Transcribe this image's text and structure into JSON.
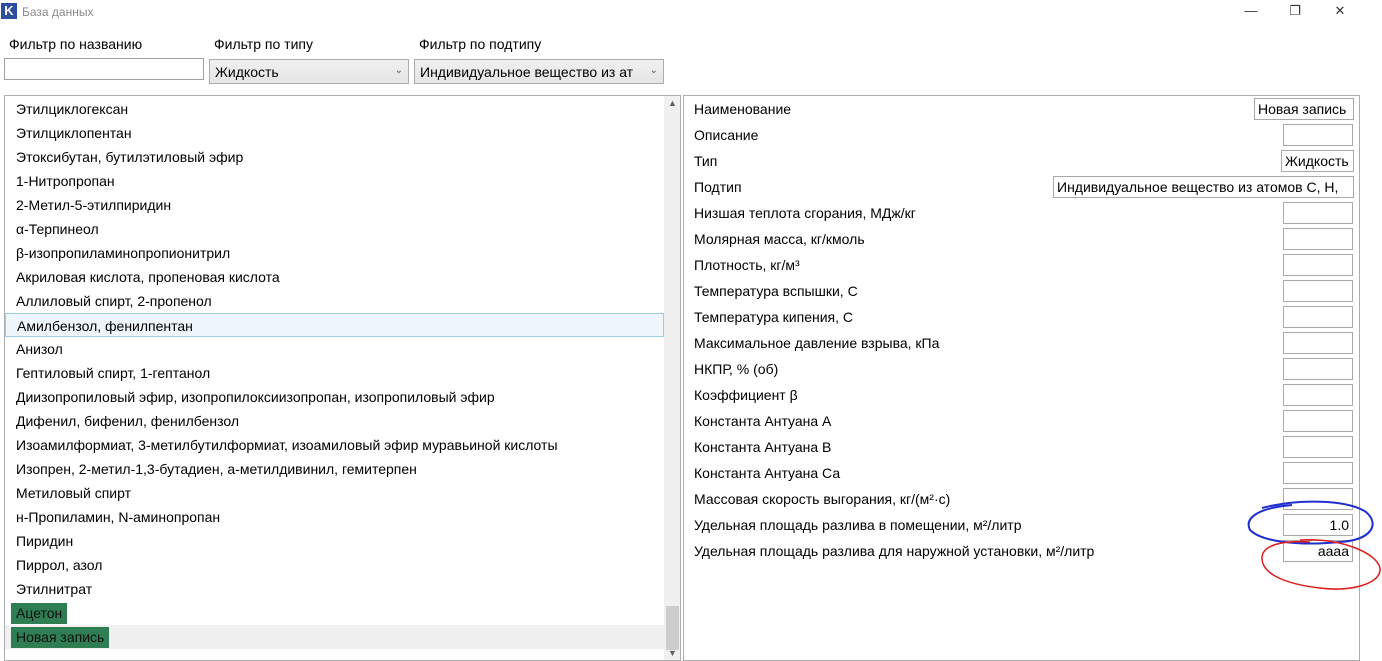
{
  "window": {
    "title": "База данных",
    "app_icon_letter": "K",
    "minimize_glyph": "—",
    "restore_glyph": "❐",
    "close_glyph": "✕"
  },
  "filters": {
    "name_label": "Фильтр по названию",
    "name_value": "",
    "type_label": "Фильтр по типу",
    "type_value": "Жидкость",
    "subtype_label": "Фильтр по подтипу",
    "subtype_value": "Индивидуальное вещество из ат"
  },
  "list": {
    "items": [
      "Этилциклогексан",
      "Этилциклопентан",
      "Этоксибутан, бутилэтиловый эфир",
      "1-Нитропропан",
      "2-Метил-5-этилпиридин",
      "α-Терпинеол",
      "β-изопропиламинопропионитрил",
      "Акриловая кислота, пропеновая кислота",
      "Аллиловый спирт, 2-пропенол",
      "Амилбензол, фенилпентан",
      "Анизол",
      "Гептиловый спирт, 1-гептанол",
      "Диизопропиловый эфир, изопропилоксиизопропан, изопропиловый эфир",
      "Дифенил, бифенил, фенилбензол",
      "Изоамилформиат, 3-метилбутилформиат, изоамиловый эфир муравьиной кислоты",
      "Изопрен, 2-метил-1,3-бутадиен, а-метилдивинил, гемитерпен",
      "Метиловый спирт",
      "н-Пропиламин, N-аминопропан",
      "Пиридин",
      "Пиррол, азол",
      "Этилнитрат",
      "Ацетон",
      "Новая запись"
    ],
    "selected_index": 9,
    "highlight_color": "#2f7d52"
  },
  "properties": {
    "rows": [
      {
        "label": "Наименование",
        "value": "Новая запись"
      },
      {
        "label": "Описание",
        "value": ""
      },
      {
        "label": "Тип",
        "value": "Жидкость"
      },
      {
        "label": "Подтип",
        "value": "Индивидуальное вещество из атомов С, Н,"
      },
      {
        "label": "Низшая теплота сгорания, МДж/кг",
        "value": ""
      },
      {
        "label": "Молярная масса, кг/кмоль",
        "value": ""
      },
      {
        "label": "Плотность, кг/м³",
        "value": ""
      },
      {
        "label": "Температура вспышки, С",
        "value": ""
      },
      {
        "label": "Температура кипения, С",
        "value": ""
      },
      {
        "label": "Максимальное давление взрыва, кПа",
        "value": ""
      },
      {
        "label": "НКПР, % (об)",
        "value": ""
      },
      {
        "label": "Коэффициент β",
        "value": ""
      },
      {
        "label": "Константа Антуана А",
        "value": ""
      },
      {
        "label": "Константа Антуана В",
        "value": ""
      },
      {
        "label": "Константа Антуана Са",
        "value": ""
      },
      {
        "label": "Массовая скорость выгорания, кг/(м²·с)",
        "value": ""
      },
      {
        "label": "Удельная площадь разлива в помещении, м²/литр",
        "value": "1.0"
      },
      {
        "label": "Удельная площадь разлива для наружной установки, м²/литр",
        "value": "аааа"
      }
    ]
  },
  "annotations": {
    "blue_color": "#1f2fd0",
    "red_color": "#e01b1b"
  }
}
